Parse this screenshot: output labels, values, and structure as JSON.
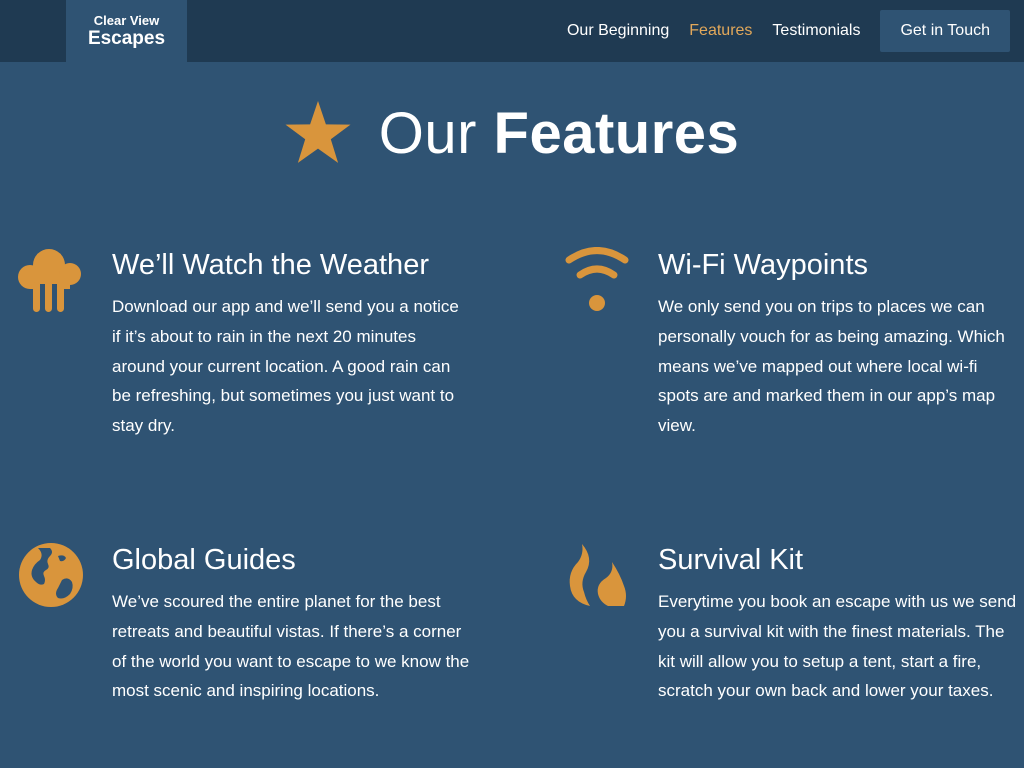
{
  "nav": {
    "logo_top": "Clear View",
    "logo_bottom": "Escapes",
    "links": [
      {
        "label": "Our Beginning"
      },
      {
        "label": "Features",
        "active": true
      },
      {
        "label": "Testimonials"
      }
    ],
    "cta_label": "Get in Touch"
  },
  "heading": {
    "light": "Our",
    "bold": "Features",
    "icon": "star-icon"
  },
  "features": [
    {
      "icon": "rain-cloud-icon",
      "title": "We’ll Watch the Weather",
      "body": "Download our app and we’ll send you a notice if it’s about to rain in the next 20 minutes around your current location. A good rain can be refreshing, but sometimes you just want to stay dry."
    },
    {
      "icon": "wifi-icon",
      "title": "Wi-Fi Waypoints",
      "body": "We only send you on trips to places we can personally vouch for as being amazing. Which means we’ve mapped out where local wi-fi spots are and marked them in our app’s map view."
    },
    {
      "icon": "globe-icon",
      "title": "Global Guides",
      "body": "We’ve scoured the entire planet for the best retreats and beautiful vistas. If there’s a corner of the world you want to escape to we know the most scenic and inspiring locations."
    },
    {
      "icon": "fire-icon",
      "title": "Survival Kit",
      "body": "Everytime you book an escape with us we send you a survival kit with the finest materials. The kit will allow you to setup a tent, start a fire, scratch your own back and lower your taxes."
    }
  ],
  "colors": {
    "background": "#2f5373",
    "navbar": "#1f3a52",
    "accent": "#e2a85a",
    "icon": "#d9953c"
  }
}
